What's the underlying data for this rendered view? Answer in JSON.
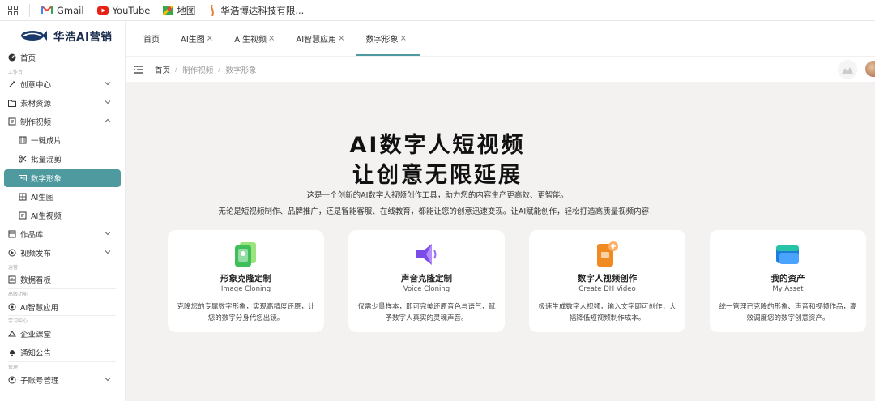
{
  "bookmarks": [
    {
      "label": "Gmail",
      "icon": "gmail-icon"
    },
    {
      "label": "YouTube",
      "icon": "youtube-icon"
    },
    {
      "label": "地图",
      "icon": "maps-icon"
    },
    {
      "label": "华浩博达科技有限...",
      "icon": "site-icon"
    }
  ],
  "brand": {
    "name": "华浩AI营销"
  },
  "sidebar": {
    "home": "首页",
    "section_workbench": "工作台",
    "creative_center": "创意中心",
    "materials": "素材资源",
    "make_video": "制作视频",
    "one_click": "一键成片",
    "batch_mix": "批量混剪",
    "digital_avatar": "数字形象",
    "ai_image": "AI生图",
    "ai_video": "AI生视频",
    "works": "作品库",
    "video_publish": "视频发布",
    "section_ops": "运营",
    "data_board": "数据看板",
    "section_advanced": "高级功能",
    "ai_apps": "AI智慧应用",
    "section_learning": "学习中心",
    "classroom": "企业课堂",
    "notices": "通知公告",
    "section_manage": "管理",
    "sub_accounts": "子账号管理"
  },
  "tabs": [
    {
      "label": "首页",
      "closable": false
    },
    {
      "label": "AI生图",
      "closable": true
    },
    {
      "label": "AI生视频",
      "closable": true
    },
    {
      "label": "AI智慧应用",
      "closable": true
    },
    {
      "label": "数字形象",
      "closable": true
    }
  ],
  "breadcrumb": {
    "home": "首页",
    "level1": "制作视频",
    "level2": "数字形象"
  },
  "hero": {
    "title_line1": "AI数字人短视频",
    "title_line2": "让创意无限延展",
    "desc1": "这是一个创新的AI数字人视频创作工具，助力您的内容生产更高效、更智能。",
    "desc2": "无论是短视频制作、品牌推广，还是智能客服、在线教育，都能让您的创意迅速变现。让AI赋能创作，轻松打造高质量视频内容！"
  },
  "cards": [
    {
      "title": "形象克隆定制",
      "subtitle": "Image Cloning",
      "desc": "克隆您的专属数字形象，实现高精度还原，让您的数字分身代您出镜。",
      "icon": "image-clone-icon"
    },
    {
      "title": "声音克隆定制",
      "subtitle": "Voice Cloning",
      "desc": "仅需少量样本，即可完美还原音色与语气，赋予数字人真实的灵魂声音。",
      "icon": "voice-clone-icon"
    },
    {
      "title": "数字人视频创作",
      "subtitle": "Create DH Video",
      "desc": "极速生成数字人视频，输入文字即可创作，大幅降低短视频制作成本。",
      "icon": "video-create-icon"
    },
    {
      "title": "我的资产",
      "subtitle": "My Asset",
      "desc": "统一管理已克隆的形象、声音和视频作品，高效调度您的数字创意资产。",
      "icon": "asset-folder-icon"
    }
  ],
  "colors": {
    "accent": "#4f9a9e",
    "background": "#f3f2f1"
  }
}
